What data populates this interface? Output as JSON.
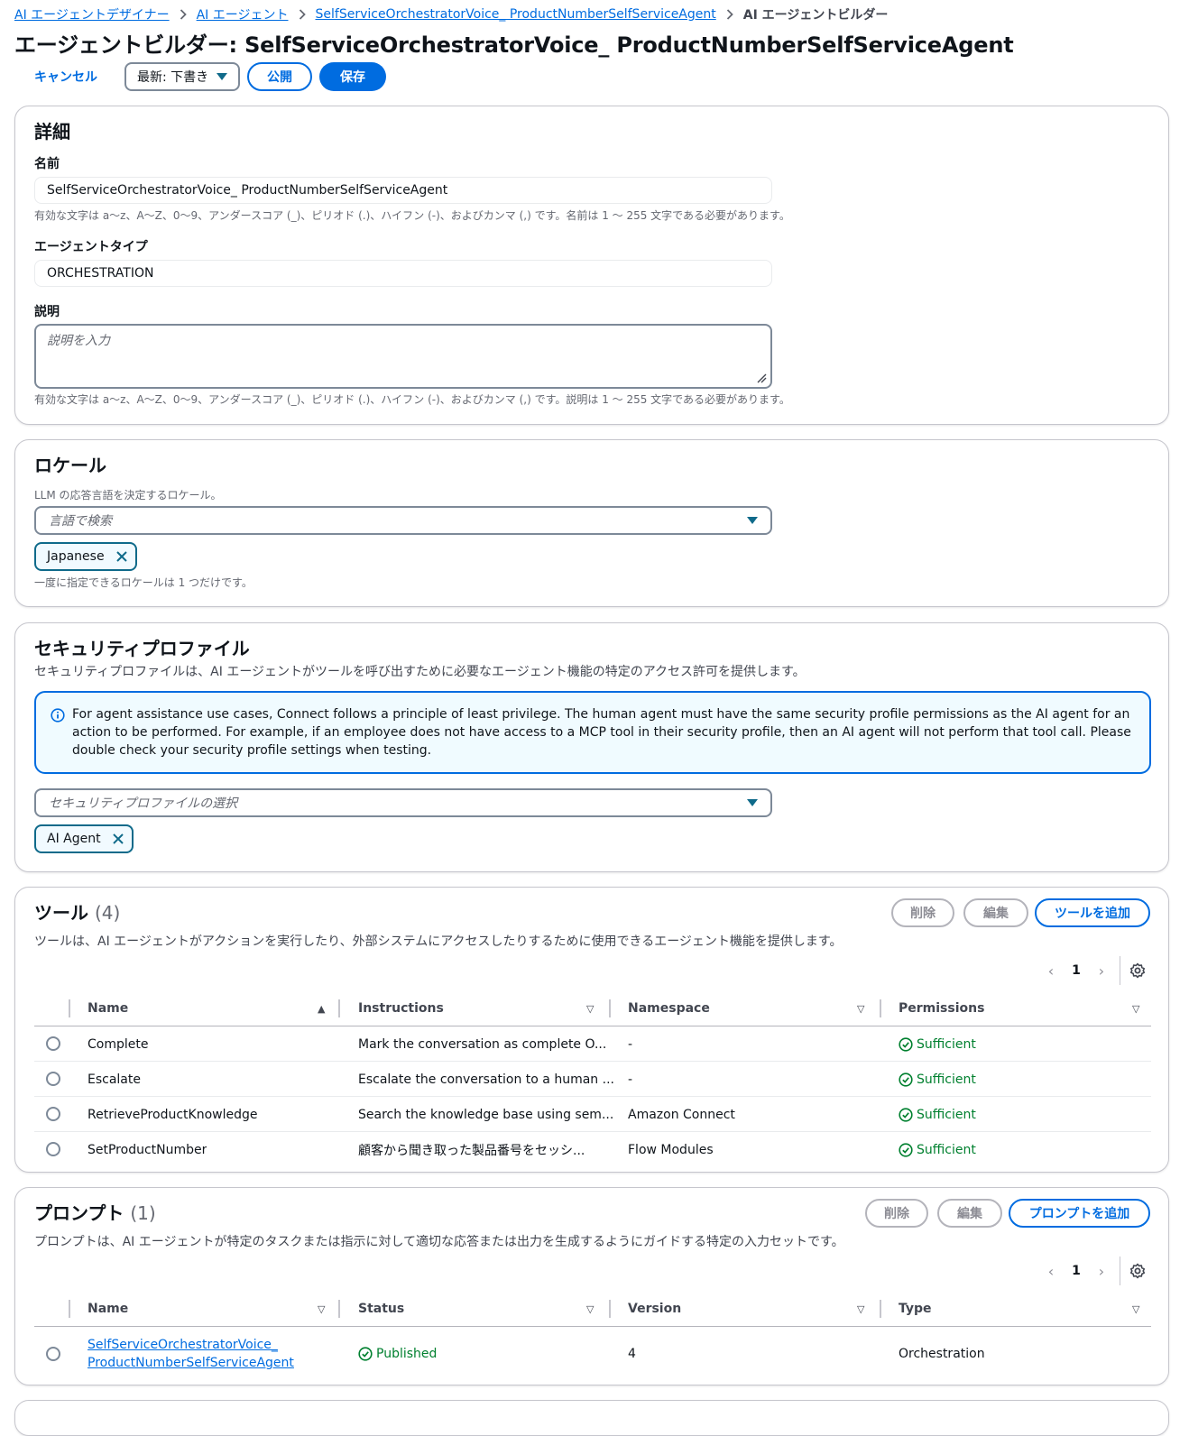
{
  "breadcrumb": {
    "items": [
      "AI エージェントデザイナー",
      "AI エージェント",
      "SelfServiceOrchestratorVoice_ ProductNumberSelfServiceAgent"
    ],
    "current": "AI エージェントビルダー"
  },
  "page_title": "エージェントビルダー: SelfServiceOrchestratorVoice_ ProductNumberSelfServiceAgent",
  "actions": {
    "cancel": "キャンセル",
    "version_select": "最新: 下書き",
    "publish": "公開",
    "save": "保存"
  },
  "details": {
    "heading": "詳細",
    "name_label": "名前",
    "name_value": "SelfServiceOrchestratorVoice_ ProductNumberSelfServiceAgent",
    "name_hint": "有効な文字は a～z、A～Z、0～9、アンダースコア (_)、ピリオド (.)、ハイフン (-)、およびカンマ (,) です。名前は 1 ～ 255 文字である必要があります。",
    "type_label": "エージェントタイプ",
    "type_value": "ORCHESTRATION",
    "desc_label": "説明",
    "desc_placeholder": "説明を入力",
    "desc_hint": "有効な文字は a～z、A～Z、0～9、アンダースコア (_)、ピリオド (.)、ハイフン (-)、およびカンマ (,) です。説明は 1 ～ 255 文字である必要があります。"
  },
  "locale": {
    "heading": "ロケール",
    "description": "LLM の応答言語を決定するロケール。",
    "placeholder": "言語で検索",
    "token": "Japanese",
    "hint": "一度に指定できるロケールは 1 つだけです。"
  },
  "security": {
    "heading": "セキュリティプロファイル",
    "description": "セキュリティプロファイルは、AI エージェントがツールを呼び出すために必要なエージェント機能の特定のアクセス許可を提供します。",
    "alert": "For agent assistance use cases, Connect follows a principle of least privilege. The human agent must have the same security profile permissions as the AI agent for an action to be performed. For example, if an employee does not have access to a MCP tool in their security profile, then an AI agent will not perform that tool call. Please double check your security profile settings when testing.",
    "placeholder": "セキュリティプロファイルの選択",
    "token": "AI Agent"
  },
  "tools": {
    "heading": "ツール",
    "count": "(4)",
    "description": "ツールは、AI エージェントがアクションを実行したり、外部システムにアクセスしたりするために使用できるエージェント機能を提供します。",
    "delete": "削除",
    "edit": "編集",
    "add": "ツールを追加",
    "page": "1",
    "columns": [
      "Name",
      "Instructions",
      "Namespace",
      "Permissions"
    ],
    "rows": [
      {
        "name": "Complete",
        "instructions": "Mark the conversation as complete O...",
        "namespace": "-",
        "permissions": "Sufficient"
      },
      {
        "name": "Escalate",
        "instructions": "Escalate the conversation to a human ...",
        "namespace": "-",
        "permissions": "Sufficient"
      },
      {
        "name": "RetrieveProductKnowledge",
        "instructions": "Search the knowledge base using sem...",
        "namespace": "Amazon Connect",
        "permissions": "Sufficient"
      },
      {
        "name": "SetProductNumber",
        "instructions": "顧客から聞き取った製品番号をセッシ...",
        "namespace": "Flow Modules",
        "permissions": "Sufficient"
      }
    ]
  },
  "prompts": {
    "heading": "プロンプト",
    "count": "(1)",
    "description": "プロンプトは、AI エージェントが特定のタスクまたは指示に対して適切な応答または出力を生成するようにガイドする特定の入力セットです。",
    "delete": "削除",
    "edit": "編集",
    "add": "プロンプトを追加",
    "page": "1",
    "columns": [
      "Name",
      "Status",
      "Version",
      "Type"
    ],
    "rows": [
      {
        "name_line1": "SelfServiceOrchestratorVoice_",
        "name_line2": "ProductNumberSelfServiceAgent",
        "status": "Published",
        "version": "4",
        "type": "Orchestration"
      }
    ]
  },
  "colors": {
    "accent": "#006ce0",
    "success": "#00802f",
    "token_border": "#0f6a8a"
  }
}
